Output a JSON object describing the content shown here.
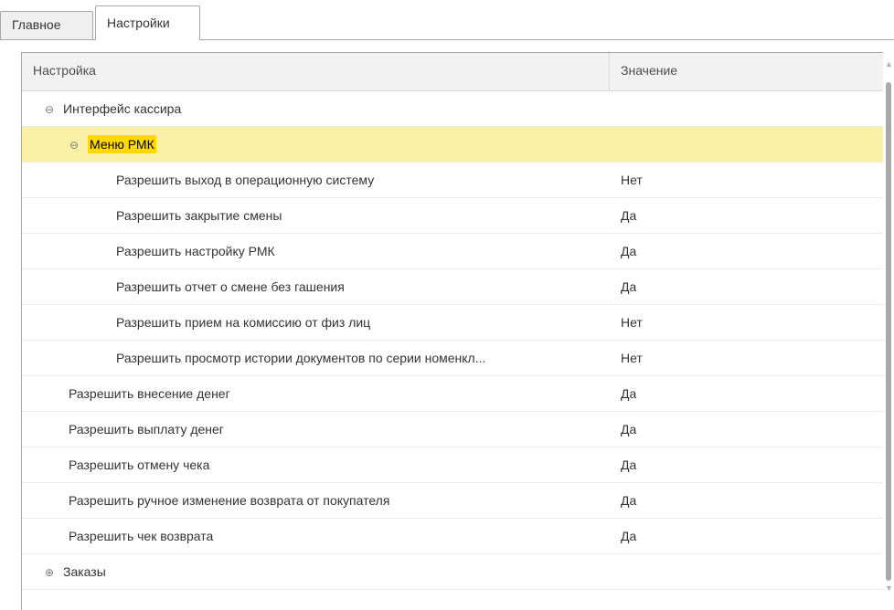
{
  "tabs": [
    {
      "label": "Главное",
      "active": false
    },
    {
      "label": "Настройки",
      "active": true
    }
  ],
  "grid": {
    "columns": [
      "Настройка",
      "Значение"
    ],
    "rows": [
      {
        "label": "Интерфейс кассира",
        "value": "",
        "level": 0,
        "toggle": "⊖",
        "selected": false
      },
      {
        "label": "Меню РМК",
        "value": "",
        "level": 1,
        "toggle": "⊖",
        "selected": true
      },
      {
        "label": "Разрешить выход в операционную систему",
        "value": "Нет",
        "level": 2,
        "toggle": "",
        "selected": false
      },
      {
        "label": "Разрешить закрытие смены",
        "value": "Да",
        "level": 2,
        "toggle": "",
        "selected": false
      },
      {
        "label": "Разрешить настройку РМК",
        "value": "Да",
        "level": 2,
        "toggle": "",
        "selected": false
      },
      {
        "label": "Разрешить отчет о смене без гашения",
        "value": "Да",
        "level": 2,
        "toggle": "",
        "selected": false
      },
      {
        "label": "Разрешить прием на комиссию от физ лиц",
        "value": "Нет",
        "level": 2,
        "toggle": "",
        "selected": false
      },
      {
        "label": "Разрешить просмотр истории документов по серии номенкл...",
        "value": "Нет",
        "level": 2,
        "toggle": "",
        "selected": false
      },
      {
        "label": "Разрешить внесение денег",
        "value": "Да",
        "level": 1,
        "toggle": "",
        "selected": false
      },
      {
        "label": "Разрешить выплату денег",
        "value": "Да",
        "level": 1,
        "toggle": "",
        "selected": false
      },
      {
        "label": "Разрешить отмену чека",
        "value": "Да",
        "level": 1,
        "toggle": "",
        "selected": false
      },
      {
        "label": "Разрешить ручное изменение возврата от покупателя",
        "value": "Да",
        "level": 1,
        "toggle": "",
        "selected": false
      },
      {
        "label": "Разрешить чек возврата",
        "value": "Да",
        "level": 1,
        "toggle": "",
        "selected": false
      },
      {
        "label": "Заказы",
        "value": "",
        "level": 0,
        "toggle": "⊕",
        "selected": false
      }
    ]
  },
  "colors": {
    "selected_row": "#fbf1a6",
    "selected_label": "#ffd800"
  }
}
